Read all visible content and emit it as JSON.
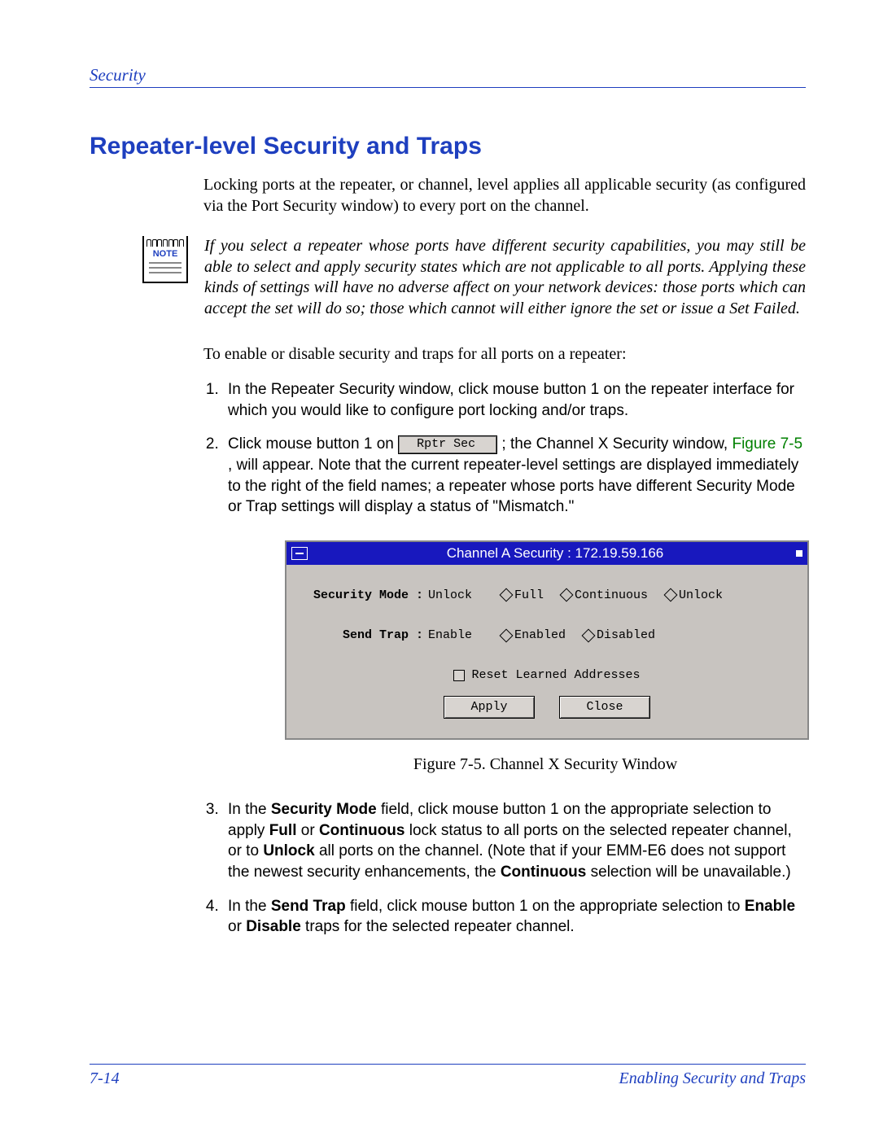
{
  "header": {
    "section": "Security"
  },
  "title": "Repeater-level Security and Traps",
  "intro_para": "Locking ports at the repeater, or channel, level applies all applicable security (as configured via the Port Security window) to every port on the channel.",
  "note": {
    "label": "NOTE",
    "text": "If you select a repeater whose ports have different security capabilities, you may still be able to select and apply security states which are not applicable to all ports. Applying these kinds of settings will have no adverse affect on your network devices: those ports which can accept the set will do so; those which cannot will either ignore the set or issue a Set Failed."
  },
  "lead_in": "To enable or disable security and traps for all ports on a repeater:",
  "steps": {
    "s1": "In the Repeater Security window, click mouse button 1 on the repeater interface for which you would like to configure port locking and/or traps.",
    "s2_pre": "Click mouse button 1 on ",
    "s2_btn": "Rptr Sec",
    "s2_mid": "; the Channel X Security window, ",
    "s2_ref": "Figure 7-5",
    "s2_post": ", will appear. Note that the current repeater-level settings are displayed immediately to the right of the field names; a repeater whose ports have different Security Mode or Trap settings will display a status of \"Mismatch.\"",
    "s3_a": "In the ",
    "s3_b": "Security Mode",
    "s3_c": " field, click mouse button 1 on the appropriate selection to apply ",
    "s3_d": "Full",
    "s3_e": " or ",
    "s3_f": "Continuous",
    "s3_g": " lock status to all ports on the selected repeater channel, or to ",
    "s3_h": "Unlock",
    "s3_i": " all ports on the channel. (Note that if your EMM-E6 does not support the newest security enhancements, the ",
    "s3_j": "Continuous",
    "s3_k": " selection will be unavailable.)",
    "s4_a": "In the ",
    "s4_b": "Send Trap",
    "s4_c": " field, click mouse button 1 on the appropriate selection to ",
    "s4_d": "Enable",
    "s4_e": " or ",
    "s4_f": "Disable",
    "s4_g": " traps for the selected repeater channel."
  },
  "figure": {
    "title": "Channel A Security : 172.19.59.166",
    "sec_mode_label": "Security Mode :",
    "sec_mode_value": "Unlock",
    "sec_opts": [
      "Full",
      "Continuous",
      "Unlock"
    ],
    "trap_label": "Send Trap :",
    "trap_value": "Enable",
    "trap_opts": [
      "Enabled",
      "Disabled"
    ],
    "reset": "Reset Learned Addresses",
    "apply": "Apply",
    "close": "Close",
    "caption": "Figure 7-5. Channel X Security Window"
  },
  "footer": {
    "page": "7-14",
    "right": "Enabling Security and Traps"
  }
}
